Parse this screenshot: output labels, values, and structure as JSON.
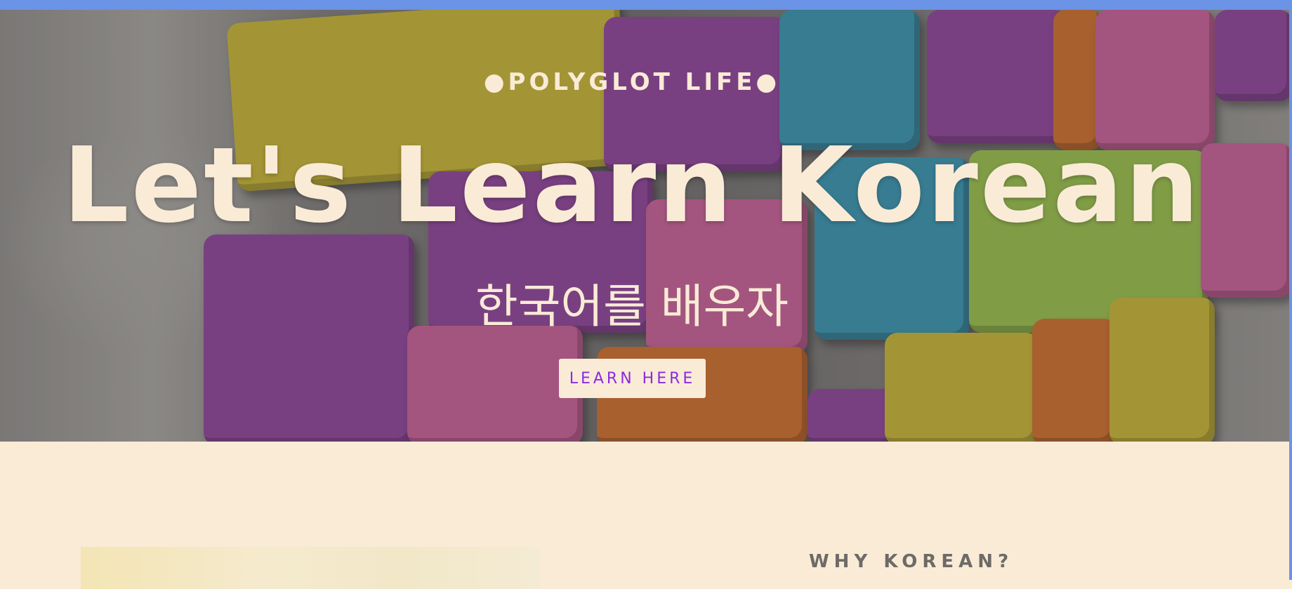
{
  "hero": {
    "eyebrow": "●POLYGLOT LIFE●",
    "title": "Let's Learn Korean",
    "subtitle": "한국어를 배우자",
    "cta_label": "LEARN HERE"
  },
  "section": {
    "heading": "WHY KOREAN?"
  },
  "colors": {
    "accent": "#8a2be2",
    "cream": "#faebd7",
    "browser_bar": "#6b93e6",
    "heading_gray": "#6e6a66"
  }
}
